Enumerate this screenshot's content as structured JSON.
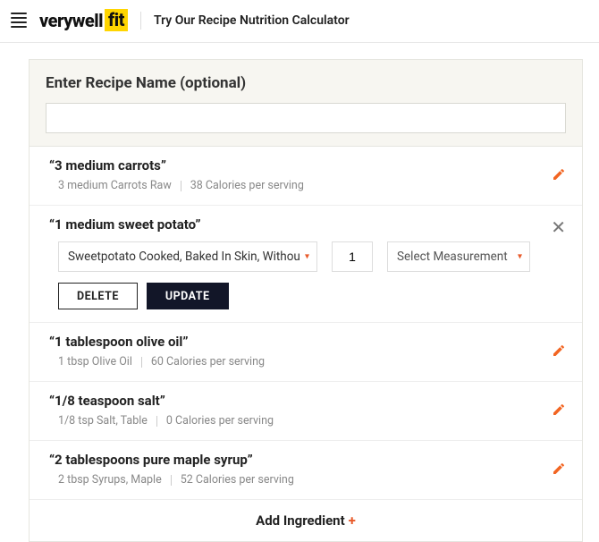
{
  "header": {
    "brand_main": "verywell",
    "brand_suffix": "fit",
    "tagline": "Try Our Recipe Nutrition Calculator"
  },
  "card": {
    "title": "Enter Recipe Name (optional)",
    "name_value": ""
  },
  "editing": {
    "food_option": "Sweetpotato Cooked, Baked In Skin, Withou",
    "qty": "1",
    "measurement": "Select Measurement",
    "delete_label": "DELETE",
    "update_label": "UPDATE"
  },
  "ingredients": [
    {
      "title": "“3 medium carrots”",
      "desc": "3 medium Carrots Raw",
      "cals": "38 Calories per serving",
      "editing": false
    },
    {
      "title": "“1 medium sweet potato”",
      "desc": "",
      "cals": "",
      "editing": true
    },
    {
      "title": "“1 tablespoon olive oil”",
      "desc": "1 tbsp Olive Oil",
      "cals": "60 Calories per serving",
      "editing": false
    },
    {
      "title": "“1/8 teaspoon salt”",
      "desc": "1/8 tsp Salt, Table",
      "cals": "0 Calories per serving",
      "editing": false
    },
    {
      "title": "“2 tablespoons pure maple syrup”",
      "desc": "2 tbsp Syrups, Maple",
      "cals": "52 Calories per serving",
      "editing": false
    }
  ],
  "add_label": "Add Ingredient"
}
